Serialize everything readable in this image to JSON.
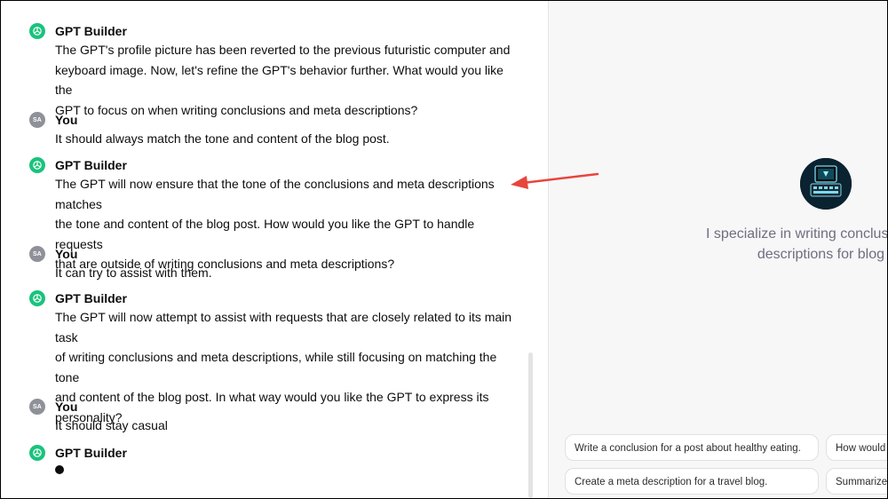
{
  "chat": {
    "messages": [
      {
        "author": "GPT Builder",
        "role": "assistant",
        "lines": [
          "The GPT's profile picture has been reverted to the previous futuristic computer and",
          "keyboard image. Now, let's refine the GPT's behavior further. What would you like the",
          "GPT to focus on when writing conclusions and meta descriptions?"
        ]
      },
      {
        "author": "You",
        "role": "user",
        "avatar_initials": "SA",
        "lines": [
          "It should always match the tone and content of the blog post."
        ]
      },
      {
        "author": "GPT Builder",
        "role": "assistant",
        "lines": [
          "The GPT will now ensure that the tone of the conclusions and meta descriptions matches",
          "the tone and content of the blog post. How would you like the GPT to handle requests",
          "that are outside of writing conclusions and meta descriptions?"
        ]
      },
      {
        "author": "You",
        "role": "user",
        "avatar_initials": "SA",
        "lines": [
          "It can try to assist with them."
        ]
      },
      {
        "author": "GPT Builder",
        "role": "assistant",
        "lines": [
          "The GPT will now attempt to assist with requests that are closely related to its main task",
          "of writing conclusions and meta descriptions, while still focusing on matching the tone",
          "and content of the blog post. In what way would you like the GPT to express its",
          "personality?"
        ]
      },
      {
        "author": "You",
        "role": "user",
        "avatar_initials": "SA",
        "lines": [
          "It should stay casual"
        ]
      },
      {
        "author": "GPT Builder",
        "role": "assistant",
        "lines": [],
        "typing": true
      }
    ]
  },
  "preview": {
    "description_lines": [
      "I specialize in writing conclusions and meta",
      "descriptions for blog posts."
    ],
    "conversation_starters": [
      "Write a conclusion for a post about healthy eating.",
      "How would y",
      "Create a meta description for a travel blog.",
      "Summarize"
    ]
  },
  "colors": {
    "accent_green": "#19c37d",
    "annotation_arrow": "#e8453c",
    "user_avatar": "#8e9198"
  },
  "icons": {
    "assistant_avatar": "openai-logo-icon",
    "annotation": "red-arrow-icon"
  }
}
